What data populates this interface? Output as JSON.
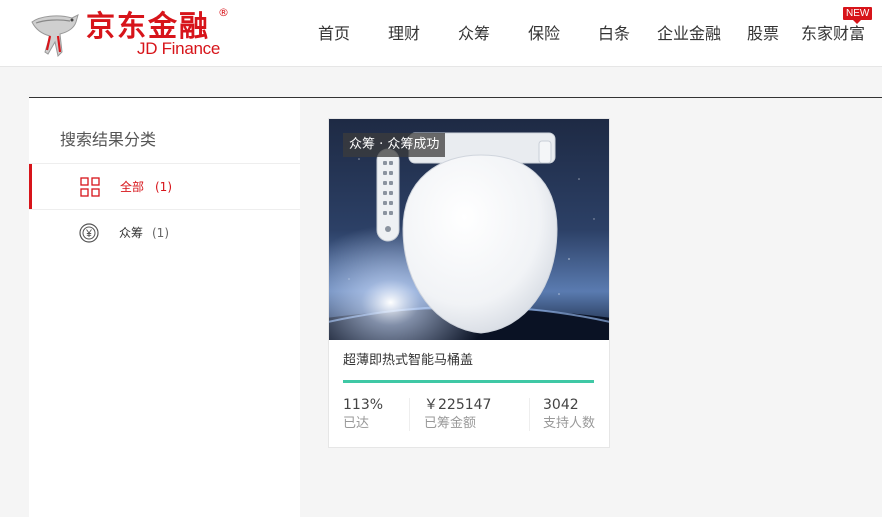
{
  "header": {
    "logo_cn": "京东金融",
    "logo_reg": "®",
    "logo_en": "JD Finance",
    "nav": [
      {
        "label": "首页"
      },
      {
        "label": "理财"
      },
      {
        "label": "众筹"
      },
      {
        "label": "保险"
      },
      {
        "label": "白条"
      },
      {
        "label": "企业金融"
      },
      {
        "label": "股票"
      },
      {
        "label": "东家财富"
      }
    ],
    "new_badge": "NEW",
    "brand_color": "#d7141a"
  },
  "sidebar": {
    "title": "搜索结果分类",
    "items": [
      {
        "label": "全部",
        "count": "(1)",
        "icon": "grid-icon",
        "active": true
      },
      {
        "label": "众筹",
        "count": "(1)",
        "icon": "yen-coin-icon",
        "active": false
      }
    ]
  },
  "results": [
    {
      "tag": "众筹 · 众筹成功",
      "title": "超薄即热式智能马桶盖",
      "progress": 1.0,
      "progress_color": "#3fc8a5",
      "stats": [
        {
          "value": "113%",
          "label": "已达"
        },
        {
          "value": "￥225147",
          "label": "已筹金额"
        },
        {
          "value": "3042",
          "label": "支持人数"
        }
      ]
    }
  ]
}
